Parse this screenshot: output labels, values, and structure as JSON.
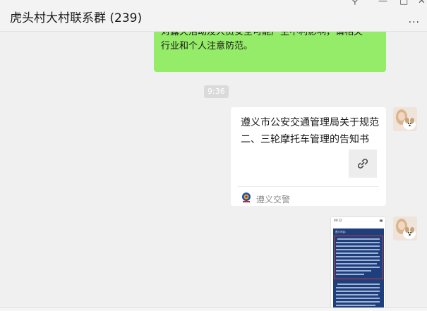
{
  "window": {
    "title": "虎头村大村联系群 (239)",
    "pin_glyph": "⚲",
    "minimize_glyph": "—",
    "maximize_glyph": "□",
    "close_glyph": "✕",
    "more_glyph": "···"
  },
  "messages": {
    "previous_text": {
      "lines": [
        "对露天活动及人员安全可能产生不利影响，请相关",
        "行业和个人注意防范。"
      ],
      "bubble_color": "#95ec69"
    },
    "timestamp": "9:36",
    "link_card": {
      "title": "遵义市公安交通管理局关于规范二、三轮摩托车管理的告知书",
      "thumbnail_icon": "link-icon",
      "source_name": "遵义交警",
      "source_icon": "police-badge-icon"
    },
    "image_message": {
      "description_icon": "document-screenshot-icon",
      "status_time": "09:12",
      "header_text": "遵义市民："
    }
  },
  "colors": {
    "background": "#f0f0f0",
    "self_bubble": "#95ec69",
    "timestamp_bg": "#dadada"
  }
}
